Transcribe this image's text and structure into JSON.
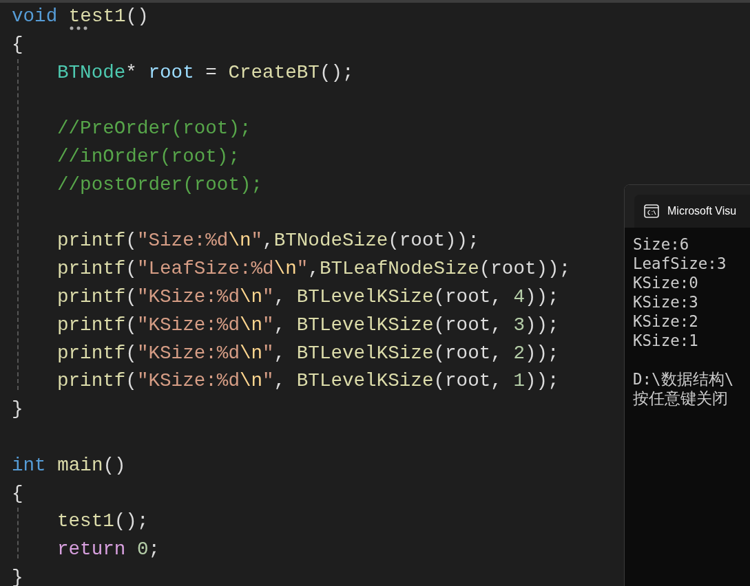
{
  "editor": {
    "functions": [
      {
        "signature": [
          {
            "kind": "keyword",
            "text": "void "
          },
          {
            "kind": "func",
            "text": "test1"
          },
          {
            "kind": "plain",
            "text": "()"
          }
        ],
        "hint_dots": true,
        "open": "{",
        "close": "}",
        "body": [
          {
            "kind": "code",
            "tokens": [
              {
                "kind": "type",
                "text": "BTNode"
              },
              {
                "kind": "plain",
                "text": "* "
              },
              {
                "kind": "var",
                "text": "root"
              },
              {
                "kind": "plain",
                "text": " = "
              },
              {
                "kind": "func",
                "text": "CreateBT"
              },
              {
                "kind": "plain",
                "text": "();"
              }
            ]
          },
          {
            "kind": "blank"
          },
          {
            "kind": "code",
            "tokens": [
              {
                "kind": "comment",
                "text": "//PreOrder(root);"
              }
            ]
          },
          {
            "kind": "code",
            "tokens": [
              {
                "kind": "comment",
                "text": "//inOrder(root);"
              }
            ]
          },
          {
            "kind": "code",
            "tokens": [
              {
                "kind": "comment",
                "text": "//postOrder(root);"
              }
            ]
          },
          {
            "kind": "blank"
          },
          {
            "kind": "code",
            "tokens": [
              {
                "kind": "func",
                "text": "printf"
              },
              {
                "kind": "plain",
                "text": "("
              },
              {
                "kind": "string",
                "text": "\"Size:%d"
              },
              {
                "kind": "escape",
                "text": "\\n"
              },
              {
                "kind": "string",
                "text": "\""
              },
              {
                "kind": "plain",
                "text": ","
              },
              {
                "kind": "func",
                "text": "BTNodeSize"
              },
              {
                "kind": "plain",
                "text": "(root));"
              }
            ]
          },
          {
            "kind": "code",
            "tokens": [
              {
                "kind": "func",
                "text": "printf"
              },
              {
                "kind": "plain",
                "text": "("
              },
              {
                "kind": "string",
                "text": "\"LeafSize:%d"
              },
              {
                "kind": "escape",
                "text": "\\n"
              },
              {
                "kind": "string",
                "text": "\""
              },
              {
                "kind": "plain",
                "text": ","
              },
              {
                "kind": "func",
                "text": "BTLeafNodeSize"
              },
              {
                "kind": "plain",
                "text": "(root));"
              }
            ]
          },
          {
            "kind": "code",
            "tokens": [
              {
                "kind": "func",
                "text": "printf"
              },
              {
                "kind": "plain",
                "text": "("
              },
              {
                "kind": "string",
                "text": "\"KSize:%d"
              },
              {
                "kind": "escape",
                "text": "\\n"
              },
              {
                "kind": "string",
                "text": "\""
              },
              {
                "kind": "plain",
                "text": ", "
              },
              {
                "kind": "func",
                "text": "BTLevelKSize"
              },
              {
                "kind": "plain",
                "text": "(root, "
              },
              {
                "kind": "number",
                "text": "4"
              },
              {
                "kind": "plain",
                "text": "));"
              }
            ]
          },
          {
            "kind": "code",
            "tokens": [
              {
                "kind": "func",
                "text": "printf"
              },
              {
                "kind": "plain",
                "text": "("
              },
              {
                "kind": "string",
                "text": "\"KSize:%d"
              },
              {
                "kind": "escape",
                "text": "\\n"
              },
              {
                "kind": "string",
                "text": "\""
              },
              {
                "kind": "plain",
                "text": ", "
              },
              {
                "kind": "func",
                "text": "BTLevelKSize"
              },
              {
                "kind": "plain",
                "text": "(root, "
              },
              {
                "kind": "number",
                "text": "3"
              },
              {
                "kind": "plain",
                "text": "));"
              }
            ]
          },
          {
            "kind": "code",
            "tokens": [
              {
                "kind": "func",
                "text": "printf"
              },
              {
                "kind": "plain",
                "text": "("
              },
              {
                "kind": "string",
                "text": "\"KSize:%d"
              },
              {
                "kind": "escape",
                "text": "\\n"
              },
              {
                "kind": "string",
                "text": "\""
              },
              {
                "kind": "plain",
                "text": ", "
              },
              {
                "kind": "func",
                "text": "BTLevelKSize"
              },
              {
                "kind": "plain",
                "text": "(root, "
              },
              {
                "kind": "number",
                "text": "2"
              },
              {
                "kind": "plain",
                "text": "));"
              }
            ]
          },
          {
            "kind": "code",
            "tokens": [
              {
                "kind": "func",
                "text": "printf"
              },
              {
                "kind": "plain",
                "text": "("
              },
              {
                "kind": "string",
                "text": "\"KSize:%d"
              },
              {
                "kind": "escape",
                "text": "\\n"
              },
              {
                "kind": "string",
                "text": "\""
              },
              {
                "kind": "plain",
                "text": ", "
              },
              {
                "kind": "func",
                "text": "BTLevelKSize"
              },
              {
                "kind": "plain",
                "text": "(root, "
              },
              {
                "kind": "number",
                "text": "1"
              },
              {
                "kind": "plain",
                "text": "));"
              }
            ]
          }
        ]
      },
      {
        "signature": [
          {
            "kind": "keyword",
            "text": "int "
          },
          {
            "kind": "func",
            "text": "main"
          },
          {
            "kind": "plain",
            "text": "()"
          }
        ],
        "hint_dots": false,
        "open": "{",
        "close": "}",
        "body": [
          {
            "kind": "code",
            "tokens": [
              {
                "kind": "func",
                "text": "test1"
              },
              {
                "kind": "plain",
                "text": "();"
              }
            ]
          },
          {
            "kind": "code",
            "tokens": [
              {
                "kind": "control",
                "text": "return "
              },
              {
                "kind": "number",
                "text": "0"
              },
              {
                "kind": "plain",
                "text": ";"
              }
            ]
          }
        ]
      }
    ]
  },
  "console": {
    "title": "Microsoft Visu",
    "output": [
      {
        "kind": "text",
        "text": "Size:6"
      },
      {
        "kind": "text",
        "text": "LeafSize:3"
      },
      {
        "kind": "text",
        "text": "KSize:0"
      },
      {
        "kind": "text",
        "text": "KSize:3"
      },
      {
        "kind": "text",
        "text": "KSize:2"
      },
      {
        "kind": "text",
        "text": "KSize:1"
      },
      {
        "kind": "blank"
      },
      {
        "kind": "text",
        "text": "D:\\数据结构\\"
      },
      {
        "kind": "text",
        "text": "按任意键关闭"
      }
    ]
  }
}
